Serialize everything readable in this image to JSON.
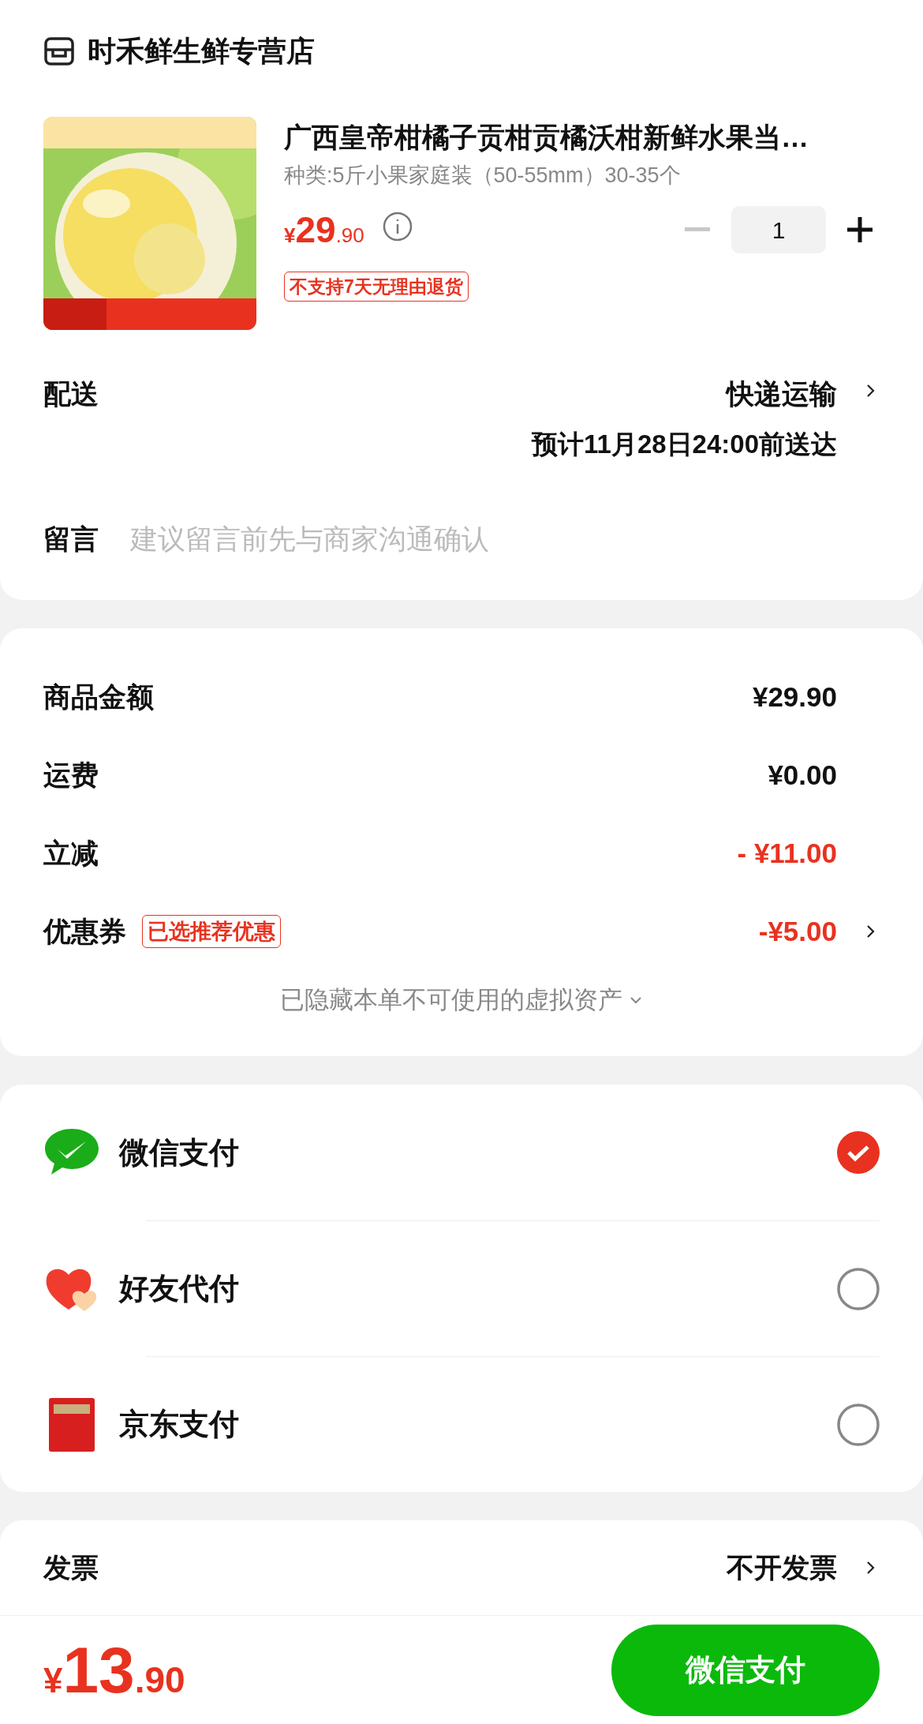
{
  "store": {
    "name": "时禾鲜生鲜专营店"
  },
  "product": {
    "title": "广西皇帝柑橘子贡柑贡橘沃柑新鲜水果当…",
    "variant": "种类:5斤小果家庭装（50-55mm）30-35个",
    "price": {
      "currency": "¥",
      "integer": "29",
      "decimal": ".90"
    },
    "quantity": "1",
    "minus_disabled": true,
    "tag": "不支持7天无理由退货"
  },
  "delivery": {
    "label": "配送",
    "method": "快递运输",
    "eta": "预计11月28日24:00前送达"
  },
  "message": {
    "label": "留言",
    "placeholder": "建议留言前先与商家沟通确认"
  },
  "amounts": [
    {
      "kind": "plain",
      "label": "商品金额",
      "value": "¥29.90"
    },
    {
      "kind": "plain",
      "label": "运费",
      "value": "¥0.00"
    },
    {
      "kind": "discount",
      "label": "立减",
      "value": "- ¥11.00"
    },
    {
      "kind": "coupon",
      "label": "优惠券",
      "tag": "已选推荐优惠",
      "value": "-¥5.00"
    }
  ],
  "hidden_assets": "已隐藏本单不可使用的虚拟资产",
  "payments": [
    {
      "kind": "wechat",
      "label": "微信支付",
      "selected": true
    },
    {
      "kind": "friend",
      "label": "好友代付",
      "selected": false
    },
    {
      "kind": "jd",
      "label": "京东支付",
      "selected": false
    }
  ],
  "invoice": {
    "label": "发票",
    "value": "不开发票"
  },
  "footer": {
    "total": {
      "currency": "¥",
      "integer": "13",
      "decimal": ".90"
    },
    "pay_button": "微信支付"
  }
}
